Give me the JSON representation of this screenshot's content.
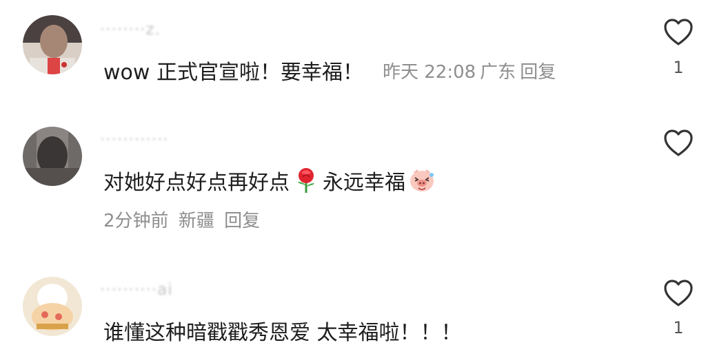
{
  "comments": [
    {
      "username": "········z.",
      "text": "wow 正式官宣啦！要幸福！",
      "time": "昨天 22:08",
      "location": "广东",
      "reply_label": "回复",
      "like_count": "1",
      "avatar_icon": "user-avatar-photo"
    },
    {
      "username": "············",
      "text_part1": "对她好点好点再好点",
      "text_part2": "永远幸福",
      "time": "2分钟前",
      "location": "新疆",
      "reply_label": "回复",
      "like_count": "",
      "emoji_1": "rose-emoji",
      "emoji_2": "laughing-pig-emoji",
      "avatar_icon": "user-avatar-photo"
    },
    {
      "username": "··········ai",
      "text": "谁懂这种暗戳戳秀恩爱 太幸福啦！！！",
      "like_count": "1",
      "avatar_icon": "user-avatar-photo"
    }
  ],
  "colors": {
    "text": "#1e1e1e",
    "meta": "#8e8e8e",
    "heart_outline": "#333333"
  },
  "icons": {
    "like": "heart-outline-icon"
  }
}
